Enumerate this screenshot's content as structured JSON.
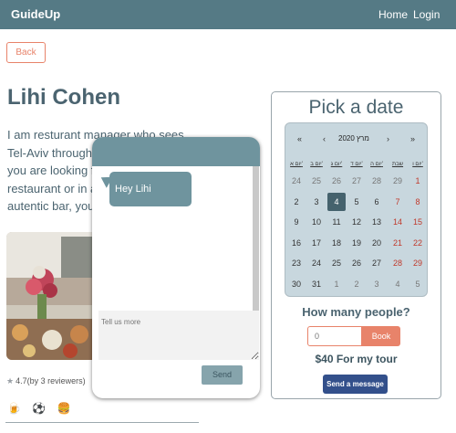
{
  "nav": {
    "brand": "GuideUp",
    "home": "Home",
    "login": "Login"
  },
  "back_label": "Back",
  "guide": {
    "name": "Lihi Cohen",
    "bio_lines": [
      "I am resturant manager who sees",
      "Tel-Aviv through",
      "you are looking f",
      "restaurant or in a",
      "autentic bar, you"
    ],
    "rating": "4.7(by 3 reviewers)",
    "interest_icons": [
      "🍺",
      "⚽",
      "🍔"
    ]
  },
  "chat": {
    "message": "Hey Lihi",
    "input_placeholder": "Tell us more",
    "send_label": "Send"
  },
  "booking": {
    "title": "Pick a date",
    "calendar": {
      "nav": [
        "«",
        "‹",
        "›",
        "»"
      ],
      "month_label": "מרץ 2020",
      "weekdays": [
        "יום א'",
        "יום ב'",
        "יום ג'",
        "יום ד'",
        "יום ה'",
        "שבת",
        "יום ו'"
      ],
      "rows": [
        [
          "24",
          "25",
          "26",
          "27",
          "28",
          "29",
          "1"
        ],
        [
          "2",
          "3",
          "4",
          "5",
          "6",
          "7",
          "8"
        ],
        [
          "9",
          "10",
          "11",
          "12",
          "13",
          "14",
          "15"
        ],
        [
          "16",
          "17",
          "18",
          "19",
          "20",
          "21",
          "22"
        ],
        [
          "23",
          "24",
          "25",
          "26",
          "27",
          "28",
          "29"
        ],
        [
          "30",
          "31",
          "1",
          "2",
          "3",
          "4",
          "5"
        ]
      ],
      "selected": "4"
    },
    "people_label": "How many people?",
    "people_value": "0",
    "book_label": "Book",
    "price": "$40 For my tour",
    "send_message_label": "Send a message"
  }
}
